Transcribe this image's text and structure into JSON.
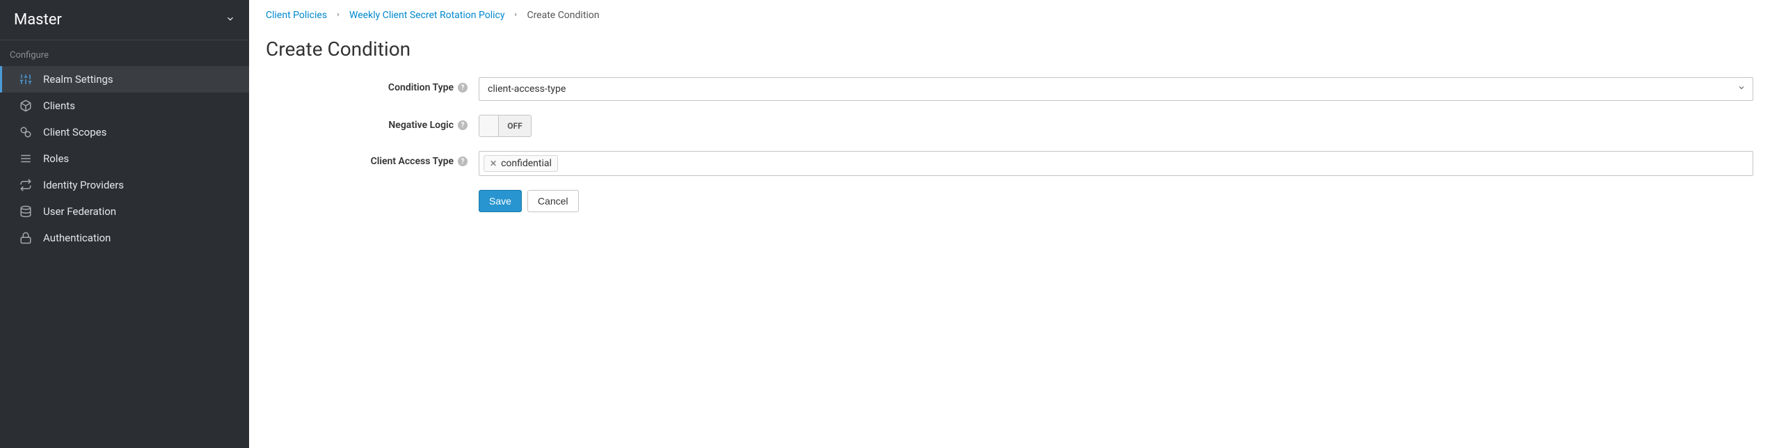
{
  "sidebar": {
    "realm": "Master",
    "section_title": "Configure",
    "items": [
      {
        "label": "Realm Settings",
        "icon": "sliders",
        "active": true
      },
      {
        "label": "Clients",
        "icon": "cube",
        "active": false
      },
      {
        "label": "Client Scopes",
        "icon": "scopes",
        "active": false
      },
      {
        "label": "Roles",
        "icon": "list",
        "active": false
      },
      {
        "label": "Identity Providers",
        "icon": "swap",
        "active": false
      },
      {
        "label": "User Federation",
        "icon": "database",
        "active": false
      },
      {
        "label": "Authentication",
        "icon": "lock",
        "active": false
      }
    ]
  },
  "breadcrumb": {
    "items": [
      {
        "label": "Client Policies",
        "link": true
      },
      {
        "label": "Weekly Client Secret Rotation Policy",
        "link": true
      },
      {
        "label": "Create Condition",
        "link": false
      }
    ]
  },
  "page": {
    "title": "Create Condition"
  },
  "form": {
    "condition_type": {
      "label": "Condition Type",
      "value": "client-access-type"
    },
    "negative_logic": {
      "label": "Negative Logic",
      "value": "OFF"
    },
    "client_access_type": {
      "label": "Client Access Type",
      "tags": [
        "confidential"
      ]
    },
    "actions": {
      "save": "Save",
      "cancel": "Cancel"
    }
  }
}
